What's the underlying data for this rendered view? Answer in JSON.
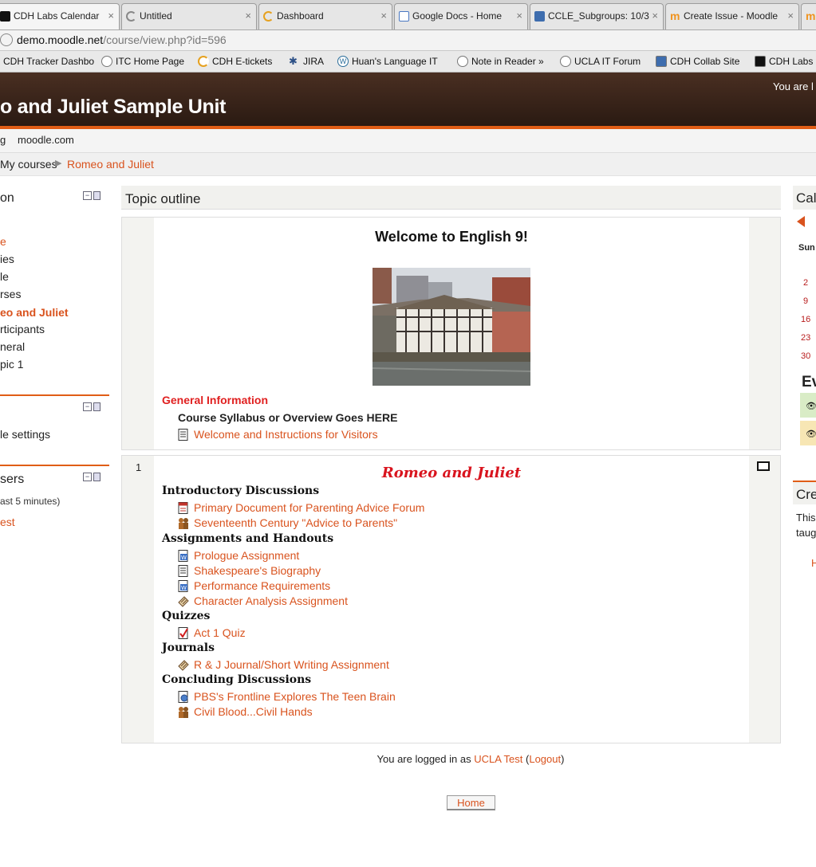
{
  "browser": {
    "tabs": [
      {
        "label": "CDH Labs Calendar",
        "icon": "cdh-icon",
        "icon_color": "#111111"
      },
      {
        "label": "Untitled",
        "icon": "loading-icon",
        "icon_color": "#888888"
      },
      {
        "label": "Dashboard",
        "icon": "loading-icon",
        "icon_color": "#e6a11f"
      },
      {
        "label": "Google Docs - Home",
        "icon": "docs-icon",
        "icon_color": "#4a78c2"
      },
      {
        "label": "CCLE_Subgroups: 10/3",
        "icon": "ucla-icon",
        "icon_color": "#3e6dae"
      },
      {
        "label": "Create Issue - Moodle",
        "icon": "moodle-icon",
        "icon_color": "#f0931e"
      }
    ],
    "close_glyph": "×",
    "address": {
      "host": "demo.moodle.net",
      "path": "/course/view.php?id=596"
    },
    "bookmarks": [
      {
        "label": "CDH Tracker Dashbo",
        "icon": "cdh-icon"
      },
      {
        "label": "ITC Home Page",
        "icon": "globe-icon"
      },
      {
        "label": "CDH E-tickets",
        "icon": "loading-icon"
      },
      {
        "label": "JIRA",
        "icon": "jira-icon"
      },
      {
        "label": "Huan's Language IT",
        "icon": "wordpress-icon"
      },
      {
        "label": "Note in Reader »",
        "icon": "globe-icon"
      },
      {
        "label": "UCLA IT Forum",
        "icon": "globe-icon"
      },
      {
        "label": "CDH Collab Site",
        "icon": "ucla-icon"
      },
      {
        "label": "CDH Labs",
        "icon": "cdh-icon"
      }
    ]
  },
  "header": {
    "site_title": "o and Juliet Sample Unit",
    "login_text": "You are l",
    "accent": "#e05d16"
  },
  "custom_menu": {
    "left_fragment": "g",
    "moodle_link": "moodle.com"
  },
  "breadcrumb": {
    "my_courses": "My courses",
    "separator": "▶",
    "course": "Romeo and Juliet"
  },
  "navigation_block": {
    "title_fragment": "on",
    "items": [
      "e",
      "ies",
      "le",
      "rses",
      "eo and Juliet",
      "rticipants",
      "neral",
      "pic 1"
    ]
  },
  "settings_block": {
    "item": "le settings"
  },
  "users_block": {
    "title_fragment": "sers",
    "note": "ast 5 minutes)",
    "user": "est"
  },
  "main": {
    "topic_outline": "Topic outline",
    "section0": {
      "welcome": "Welcome to English 9!",
      "image_alt": "Globe Theatre",
      "general_info": "General Information",
      "syllabus": "Course Syllabus or Overview Goes HERE",
      "welcome_link": "Welcome and Instructions for Visitors"
    },
    "section1": {
      "number": "1",
      "title": "Romeo and Juliet",
      "groups": [
        {
          "heading": "Introductory Discussions",
          "items": [
            {
              "label": "Primary Document for Parenting Advice Forum",
              "icon": "pdf-icon"
            },
            {
              "label": "Seventeenth Century \"Advice to Parents\"",
              "icon": "forum-icon"
            }
          ]
        },
        {
          "heading": "Assignments and Handouts",
          "items": [
            {
              "label": "Prologue Assignment",
              "icon": "word-doc-icon"
            },
            {
              "label": "Shakespeare's Biography",
              "icon": "text-page-icon"
            },
            {
              "label": "Performance Requirements",
              "icon": "word-doc-icon"
            },
            {
              "label": "Character Analysis Assignment",
              "icon": "assignment-icon"
            }
          ]
        },
        {
          "heading": "Quizzes",
          "items": [
            {
              "label": "Act 1 Quiz",
              "icon": "quiz-icon"
            }
          ]
        },
        {
          "heading": "Journals",
          "items": [
            {
              "label": "R & J Journal/Short Writing Assignment",
              "icon": "assignment-icon"
            }
          ]
        },
        {
          "heading": "Concluding Discussions",
          "items": [
            {
              "label": "PBS's Frontline Explores The Teen Brain",
              "icon": "web-link-icon"
            },
            {
              "label": "Civil Blood...Civil Hands",
              "icon": "forum-icon"
            }
          ]
        }
      ]
    }
  },
  "footer": {
    "logged_in_prefix": "You are logged in as ",
    "user": "UCLA Test",
    "logout": "Logout",
    "home_button": "Home"
  },
  "calendar_block": {
    "title_fragment": "Cal",
    "sun_label": "Sun",
    "days": [
      "2",
      "9",
      "16",
      "23",
      "30"
    ]
  },
  "events_block": {
    "title_fragment": "Ev",
    "rows": [
      {
        "color": "#d9ecc6"
      },
      {
        "color": "#f7e6b4"
      }
    ]
  },
  "create_block": {
    "title_fragment": "Cre",
    "line1": "This",
    "line2": "taug",
    "link": "H"
  }
}
